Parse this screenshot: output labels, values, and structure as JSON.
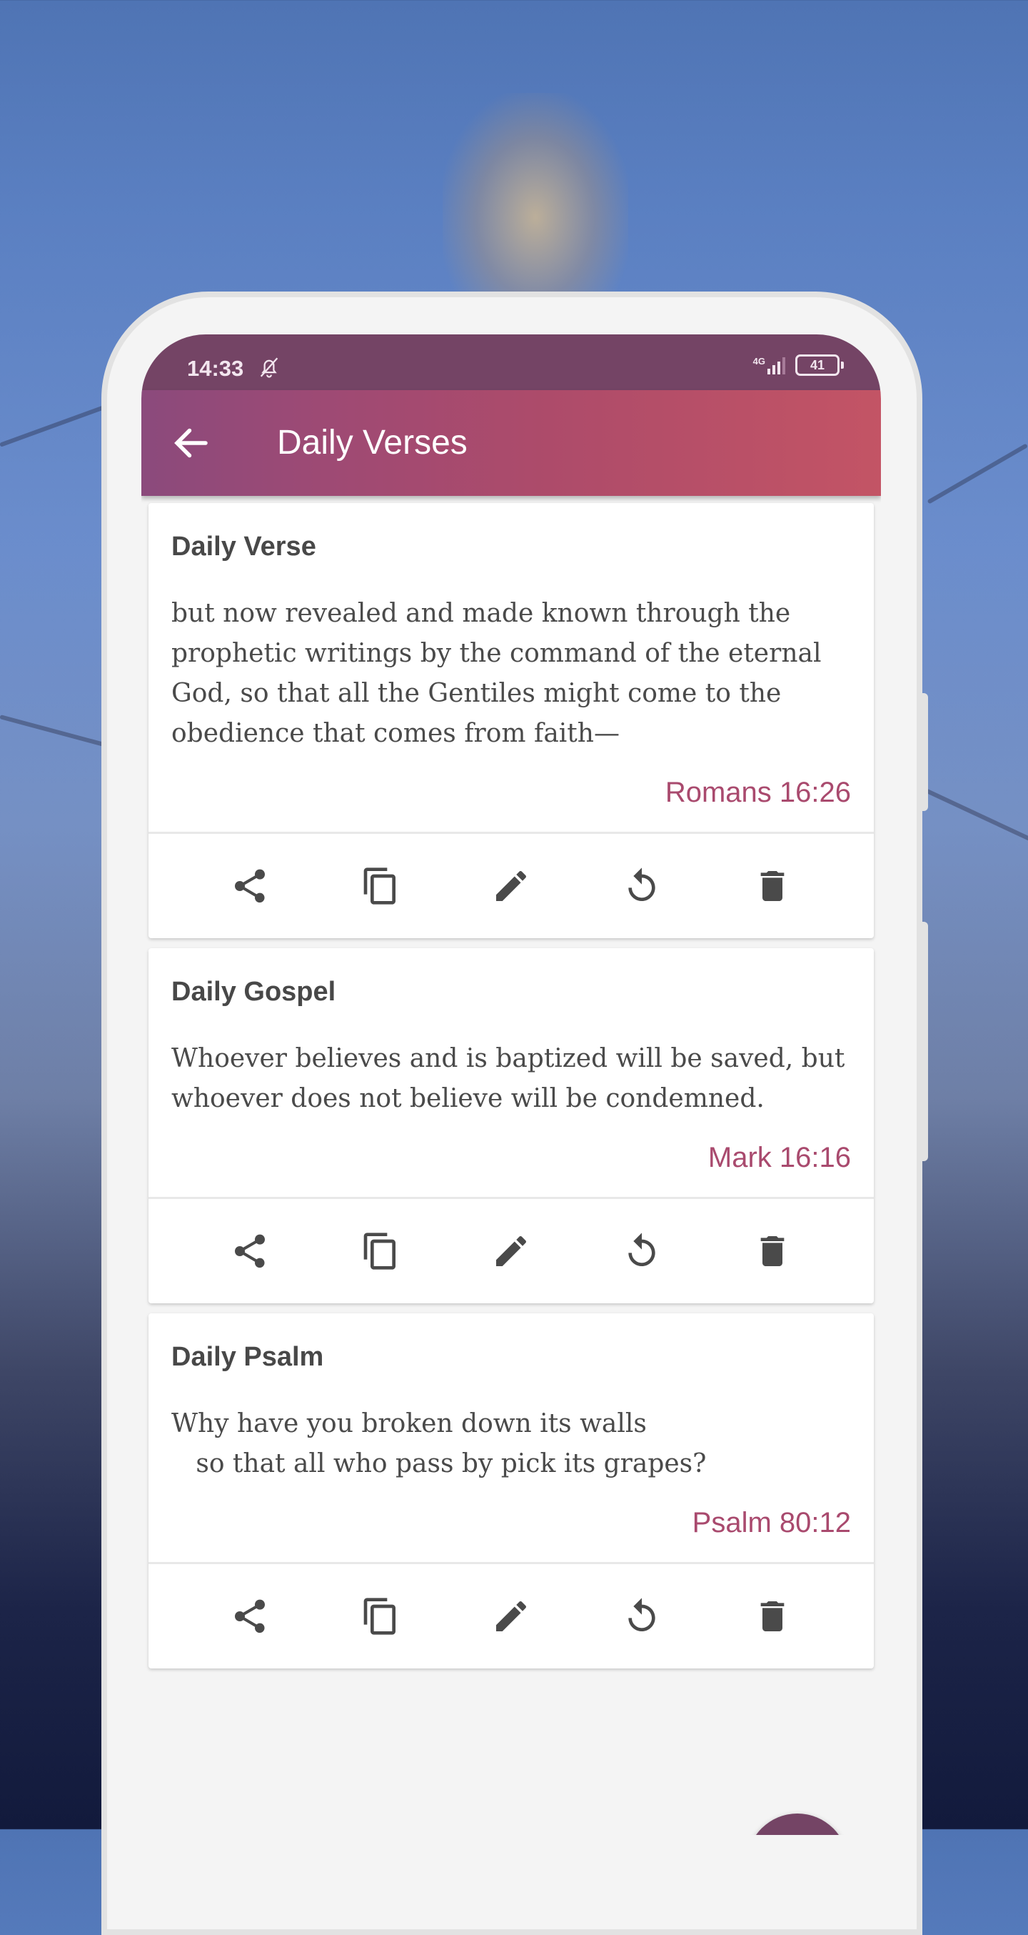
{
  "status_bar": {
    "time": "14:33",
    "network": "4G",
    "battery": "41",
    "icons": [
      "bell-off-icon",
      "signal-icon",
      "battery-icon"
    ]
  },
  "app_bar": {
    "title": "Daily Verses",
    "back_icon": "arrow-back-icon"
  },
  "colors": {
    "status_bar": "#744465",
    "app_bar_start": "#8b4a7c",
    "app_bar_end": "#c35465",
    "reference": "#a94a6e",
    "icon": "#4a4a4a"
  },
  "cards": [
    {
      "title": "Daily Verse",
      "text": "but now revealed and made known through the prophetic writings by the command of the eternal God, so that all the Gentiles might come to the obedience that comes from faith—",
      "reference": "Romans 16:26"
    },
    {
      "title": "Daily Gospel",
      "text": "Whoever believes and is baptized will be saved, but whoever does not believe will be condemned.",
      "reference": "Mark 16:16"
    },
    {
      "title": "Daily Psalm",
      "text": "Why have you broken down its walls\n   so that all who pass by pick its grapes?",
      "reference": "Psalm 80:12"
    }
  ],
  "actions": [
    "share",
    "copy",
    "edit",
    "refresh",
    "delete"
  ]
}
